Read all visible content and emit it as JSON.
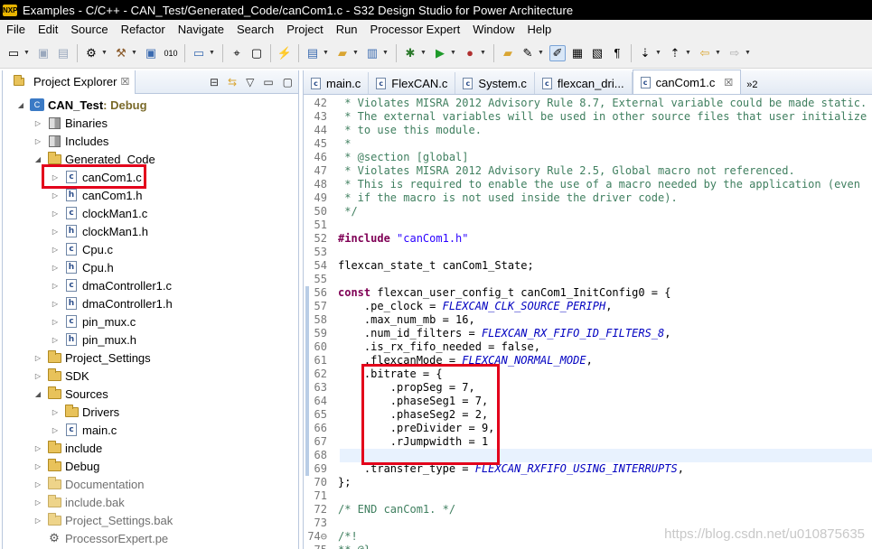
{
  "window": {
    "app_icon": "NXP",
    "title": "Examples - C/C++ - CAN_Test/Generated_Code/canCom1.c - S32 Design Studio for Power Architecture"
  },
  "menu": [
    "File",
    "Edit",
    "Source",
    "Refactor",
    "Navigate",
    "Search",
    "Project",
    "Run",
    "Processor Expert",
    "Window",
    "Help"
  ],
  "explorer": {
    "title": "Project Explorer",
    "close": "☒",
    "tree": [
      {
        "label": "CAN_Test",
        "decoration": ": Debug",
        "level": 0,
        "twist": "◢",
        "icon": "project",
        "bold": true,
        "name": "tree-item-can-test"
      },
      {
        "label": "Binaries",
        "level": 1,
        "twist": "▷",
        "icon": "binaries",
        "name": "tree-item-binaries"
      },
      {
        "label": "Includes",
        "level": 1,
        "twist": "▷",
        "icon": "includes",
        "name": "tree-item-includes"
      },
      {
        "label": "Generated_Code",
        "level": 1,
        "twist": "◢",
        "icon": "folder",
        "name": "tree-item-generated-code"
      },
      {
        "label": "canCom1.c",
        "level": 2,
        "twist": "▷",
        "icon": "c",
        "name": "tree-item-cancom1-c",
        "highlight": true
      },
      {
        "label": "canCom1.h",
        "level": 2,
        "twist": "▷",
        "icon": "h",
        "name": "tree-item-cancom1-h"
      },
      {
        "label": "clockMan1.c",
        "level": 2,
        "twist": "▷",
        "icon": "c",
        "name": "tree-item-clockman1-c"
      },
      {
        "label": "clockMan1.h",
        "level": 2,
        "twist": "▷",
        "icon": "h",
        "name": "tree-item-clockman1-h"
      },
      {
        "label": "Cpu.c",
        "level": 2,
        "twist": "▷",
        "icon": "c",
        "name": "tree-item-cpu-c"
      },
      {
        "label": "Cpu.h",
        "level": 2,
        "twist": "▷",
        "icon": "h",
        "name": "tree-item-cpu-h"
      },
      {
        "label": "dmaController1.c",
        "level": 2,
        "twist": "▷",
        "icon": "c",
        "name": "tree-item-dmacontroller1-c"
      },
      {
        "label": "dmaController1.h",
        "level": 2,
        "twist": "▷",
        "icon": "h",
        "name": "tree-item-dmacontroller1-h"
      },
      {
        "label": "pin_mux.c",
        "level": 2,
        "twist": "▷",
        "icon": "c",
        "name": "tree-item-pin-mux-c"
      },
      {
        "label": "pin_mux.h",
        "level": 2,
        "twist": "▷",
        "icon": "h",
        "name": "tree-item-pin-mux-h"
      },
      {
        "label": "Project_Settings",
        "level": 1,
        "twist": "▷",
        "icon": "folder",
        "name": "tree-item-project-settings"
      },
      {
        "label": "SDK",
        "level": 1,
        "twist": "▷",
        "icon": "folder",
        "name": "tree-item-sdk"
      },
      {
        "label": "Sources",
        "level": 1,
        "twist": "◢",
        "icon": "folder",
        "name": "tree-item-sources"
      },
      {
        "label": "Drivers",
        "level": 2,
        "twist": "▷",
        "icon": "folder",
        "name": "tree-item-drivers"
      },
      {
        "label": "main.c",
        "level": 2,
        "twist": "▷",
        "icon": "c",
        "name": "tree-item-main-c"
      },
      {
        "label": "include",
        "level": 1,
        "twist": "▷",
        "icon": "folder",
        "name": "tree-item-include"
      },
      {
        "label": "Debug",
        "level": 1,
        "twist": "▷",
        "icon": "folder",
        "name": "tree-item-debug"
      },
      {
        "label": "Documentation",
        "level": 1,
        "twist": "▷",
        "icon": "folder",
        "name": "tree-item-documentation",
        "grey": true
      },
      {
        "label": "include.bak",
        "level": 1,
        "twist": "▷",
        "icon": "folder",
        "name": "tree-item-include-bak",
        "grey": true
      },
      {
        "label": "Project_Settings.bak",
        "level": 1,
        "twist": "▷",
        "icon": "folder",
        "name": "tree-item-project-settings-bak",
        "grey": true
      },
      {
        "label": "ProcessorExpert.pe",
        "level": 1,
        "twist": "",
        "icon": "pe",
        "name": "tree-item-processorexpert-pe",
        "grey": true
      }
    ]
  },
  "editor": {
    "tabs": [
      {
        "label": "main.c",
        "active": false
      },
      {
        "label": "FlexCAN.c",
        "active": false
      },
      {
        "label": "System.c",
        "active": false
      },
      {
        "label": "flexcan_dri...",
        "active": false
      },
      {
        "label": "canCom1.c",
        "active": true
      }
    ],
    "overflow": "»2",
    "lines": [
      {
        "n": "42",
        "t": " * Violates MISRA 2012 Advisory Rule 8.7, External variable could be made static.",
        "k": "com"
      },
      {
        "n": "43",
        "t": " * The external variables will be used in other source files that user initialize",
        "k": "com"
      },
      {
        "n": "44",
        "t": " * to use this module.",
        "k": "com"
      },
      {
        "n": "45",
        "t": " *",
        "k": "com"
      },
      {
        "n": "46",
        "t": " * @section [global]",
        "k": "com"
      },
      {
        "n": "47",
        "t": " * Violates MISRA 2012 Advisory Rule 2.5, Global macro not referenced.",
        "k": "com"
      },
      {
        "n": "48",
        "t": " * This is required to enable the use of a macro needed by the application (even",
        "k": "com"
      },
      {
        "n": "49",
        "t": " * if the macro is not used inside the driver code).",
        "k": "com"
      },
      {
        "n": "50",
        "t": " */",
        "k": "com"
      },
      {
        "n": "51",
        "t": "",
        "k": "plain"
      },
      {
        "n": "52",
        "kw": "#include",
        "rest": " ",
        "str": "\"canCom1.h\"",
        "k": "include"
      },
      {
        "n": "53",
        "t": "",
        "k": "plain"
      },
      {
        "n": "54",
        "t": "flexcan_state_t canCom1_State;",
        "k": "plain"
      },
      {
        "n": "55",
        "t": "",
        "k": "plain"
      },
      {
        "n": "56",
        "kw": "const",
        "rest": " flexcan_user_config_t canCom1_InitConfig0 = {",
        "k": "kwline"
      },
      {
        "n": "57",
        "pre": "    .pe_clock = ",
        "it": "FLEXCAN_CLK_SOURCE_PERIPH",
        "post": ",",
        "k": "ital"
      },
      {
        "n": "58",
        "t": "    .max_num_mb = 16,",
        "k": "plain"
      },
      {
        "n": "59",
        "pre": "    .num_id_filters = ",
        "it": "FLEXCAN_RX_FIFO_ID_FILTERS_8",
        "post": ",",
        "k": "ital"
      },
      {
        "n": "60",
        "t": "    .is_rx_fifo_needed = false,",
        "k": "plain"
      },
      {
        "n": "61",
        "pre": "    .flexcanMode = ",
        "it": "FLEXCAN_NORMAL_MODE",
        "post": ",",
        "k": "ital"
      },
      {
        "n": "62",
        "t": "    .bitrate = {",
        "k": "plain"
      },
      {
        "n": "63",
        "t": "        .propSeg = 7,",
        "k": "plain"
      },
      {
        "n": "64",
        "t": "        .phaseSeg1 = 7,",
        "k": "plain"
      },
      {
        "n": "65",
        "t": "        .phaseSeg2 = 2,",
        "k": "plain"
      },
      {
        "n": "66",
        "t": "        .preDivider = 9,",
        "k": "plain"
      },
      {
        "n": "67",
        "t": "        .rJumpwidth = 1",
        "k": "plain"
      },
      {
        "n": "68",
        "t": "    },",
        "k": "plain"
      },
      {
        "n": "69",
        "pre": "    .transfer_type = ",
        "it": "FLEXCAN_RXFIFO_USING_INTERRUPTS",
        "post": ",",
        "k": "ital"
      },
      {
        "n": "70",
        "t": "};",
        "k": "plain"
      },
      {
        "n": "71",
        "t": "",
        "k": "plain"
      },
      {
        "n": "72",
        "t": "/* END canCom1. */",
        "k": "com"
      },
      {
        "n": "73",
        "t": "",
        "k": "plain"
      },
      {
        "n": "74⊖",
        "t": "/*!",
        "k": "com"
      },
      {
        "n": "75",
        "t": "** @}",
        "k": "com"
      }
    ]
  },
  "watermark": "https://blog.csdn.net/u010875635",
  "colors": {
    "highlight_box": "#e3001b",
    "comment": "#3f7f5f",
    "keyword": "#7f0055",
    "string": "#2a00ff",
    "enum_constant": "#0000c0"
  }
}
